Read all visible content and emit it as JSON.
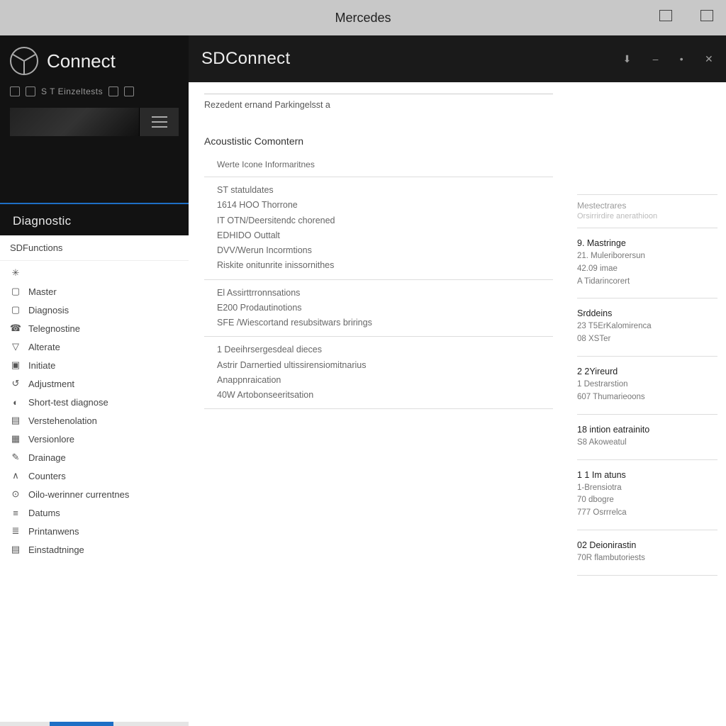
{
  "window": {
    "title": "Mercedes"
  },
  "brand": {
    "name": "Connect"
  },
  "toolrow": {
    "label": "S  T  Einzeltests"
  },
  "section": {
    "title": "Diagnostic"
  },
  "panel": {
    "head": "SDFunctions"
  },
  "nav": {
    "items": [
      {
        "icon": "✳",
        "label": ""
      },
      {
        "icon": "▢",
        "label": "Master"
      },
      {
        "icon": "▢",
        "label": "Diagnosis"
      },
      {
        "icon": "☎",
        "label": "Telegnostine"
      },
      {
        "icon": "▽",
        "label": "Alterate"
      },
      {
        "icon": "▣",
        "label": "Initiate"
      },
      {
        "icon": "↺",
        "label": "Adjustment"
      },
      {
        "icon": "◐",
        "label": "Short-test diagnose"
      },
      {
        "icon": "▤",
        "label": "Verstehenolation"
      },
      {
        "icon": "▦",
        "label": "Versionlore"
      },
      {
        "icon": "✎",
        "label": "Drainage"
      },
      {
        "icon": "∧",
        "label": "Counters"
      },
      {
        "icon": "⊙",
        "label": "Oilo-werinner currentnes"
      },
      {
        "icon": "≡",
        "label": "Datums"
      },
      {
        "icon": "≣",
        "label": "Printanwens"
      },
      {
        "icon": "▤",
        "label": "Einstadtninge"
      }
    ]
  },
  "main": {
    "title": "SDConnect",
    "breadcrumb": "Rezedent ernand Parkingelsst a",
    "subhead": "Acoustistic Comontern",
    "hint": "Werte Icone Informaritnes",
    "blocks": [
      {
        "rows": [
          "ST statuldates",
          "1614 HOO Thorrone",
          "IT OTN/Deersitendc chorened",
          "EDHIDO Outtalt",
          "DVV/Werun Incormtions",
          "Riskite onitunrite inissornithes"
        ]
      },
      {
        "rows": [
          "El Assirttrronnsations",
          "E200 Prodautinotions",
          "SFE /Wiescortand resubsitwars brirings"
        ]
      },
      {
        "rows": [
          "1 Deeihrsergesdeal dieces",
          "Astrir Darnertied ultissirensiomitnarius",
          "Anappnraication",
          "40W Artobonseeritsation"
        ]
      }
    ]
  },
  "right": {
    "head": "Mestectrares",
    "subhead": "Orsirrirdire anerathioon",
    "groups": [
      {
        "title": "9. Mastringe",
        "lines": [
          "21. Muleriborersun",
          "42.09 imae",
          "A Tidarincorert"
        ]
      },
      {
        "title": "Srddeins",
        "lines": [
          "23 T5ErKalomirenca",
          "08 XSTer"
        ]
      },
      {
        "title": "2 2Yireurd",
        "lines": [
          "1 Destrarstion",
          "607 Thumarieoons"
        ]
      },
      {
        "title": "18 intion eatrainito",
        "lines": [
          "S8 Akoweatul"
        ]
      },
      {
        "title": "1 1 Im atuns",
        "lines": [
          "1-Brensiotra",
          "70 dbogre",
          "777 Osrrrelca"
        ]
      },
      {
        "title": "02 Deionirastin",
        "lines": [
          "70R flambutoriests"
        ]
      }
    ]
  }
}
